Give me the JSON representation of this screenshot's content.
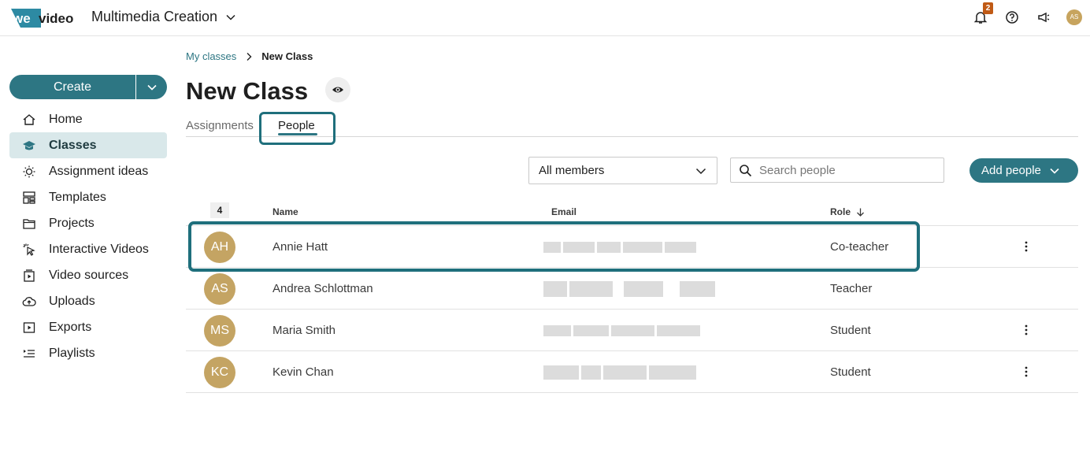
{
  "header": {
    "workspace": "Multimedia Creation",
    "notification_count": "2",
    "user_initials": "AS",
    "logo_text_we": "we",
    "logo_text_video": "video"
  },
  "sidebar": {
    "create_label": "Create",
    "items": [
      {
        "label": "Home",
        "icon": "home-icon"
      },
      {
        "label": "Classes",
        "icon": "classes-icon"
      },
      {
        "label": "Assignment ideas",
        "icon": "lightbulb-icon"
      },
      {
        "label": "Templates",
        "icon": "templates-icon"
      },
      {
        "label": "Projects",
        "icon": "folder-icon"
      },
      {
        "label": "Interactive Videos",
        "icon": "cursor-click-icon"
      },
      {
        "label": "Video sources",
        "icon": "video-sources-icon"
      },
      {
        "label": "Uploads",
        "icon": "cloud-upload-icon"
      },
      {
        "label": "Exports",
        "icon": "export-icon"
      },
      {
        "label": "Playlists",
        "icon": "playlist-icon"
      }
    ]
  },
  "breadcrumb": {
    "parent": "My classes",
    "current": "New Class"
  },
  "page": {
    "title": "New Class"
  },
  "tabs": [
    {
      "label": "Assignments"
    },
    {
      "label": "People"
    }
  ],
  "toolbar": {
    "filter_value": "All members",
    "search_placeholder": "Search people",
    "add_people_label": "Add people"
  },
  "table": {
    "count": "4",
    "columns": {
      "name": "Name",
      "email": "Email",
      "role": "Role"
    },
    "rows": [
      {
        "initials": "AH",
        "name": "Annie Hatt",
        "role": "Co-teacher"
      },
      {
        "initials": "AS",
        "name": "Andrea Schlottman",
        "role": "Teacher"
      },
      {
        "initials": "MS",
        "name": "Maria Smith",
        "role": "Student"
      },
      {
        "initials": "KC",
        "name": "Kevin Chan",
        "role": "Student"
      }
    ]
  },
  "colors": {
    "accent": "#2d7683",
    "avatar": "#c4a463",
    "highlight": "#1f6f7c"
  }
}
